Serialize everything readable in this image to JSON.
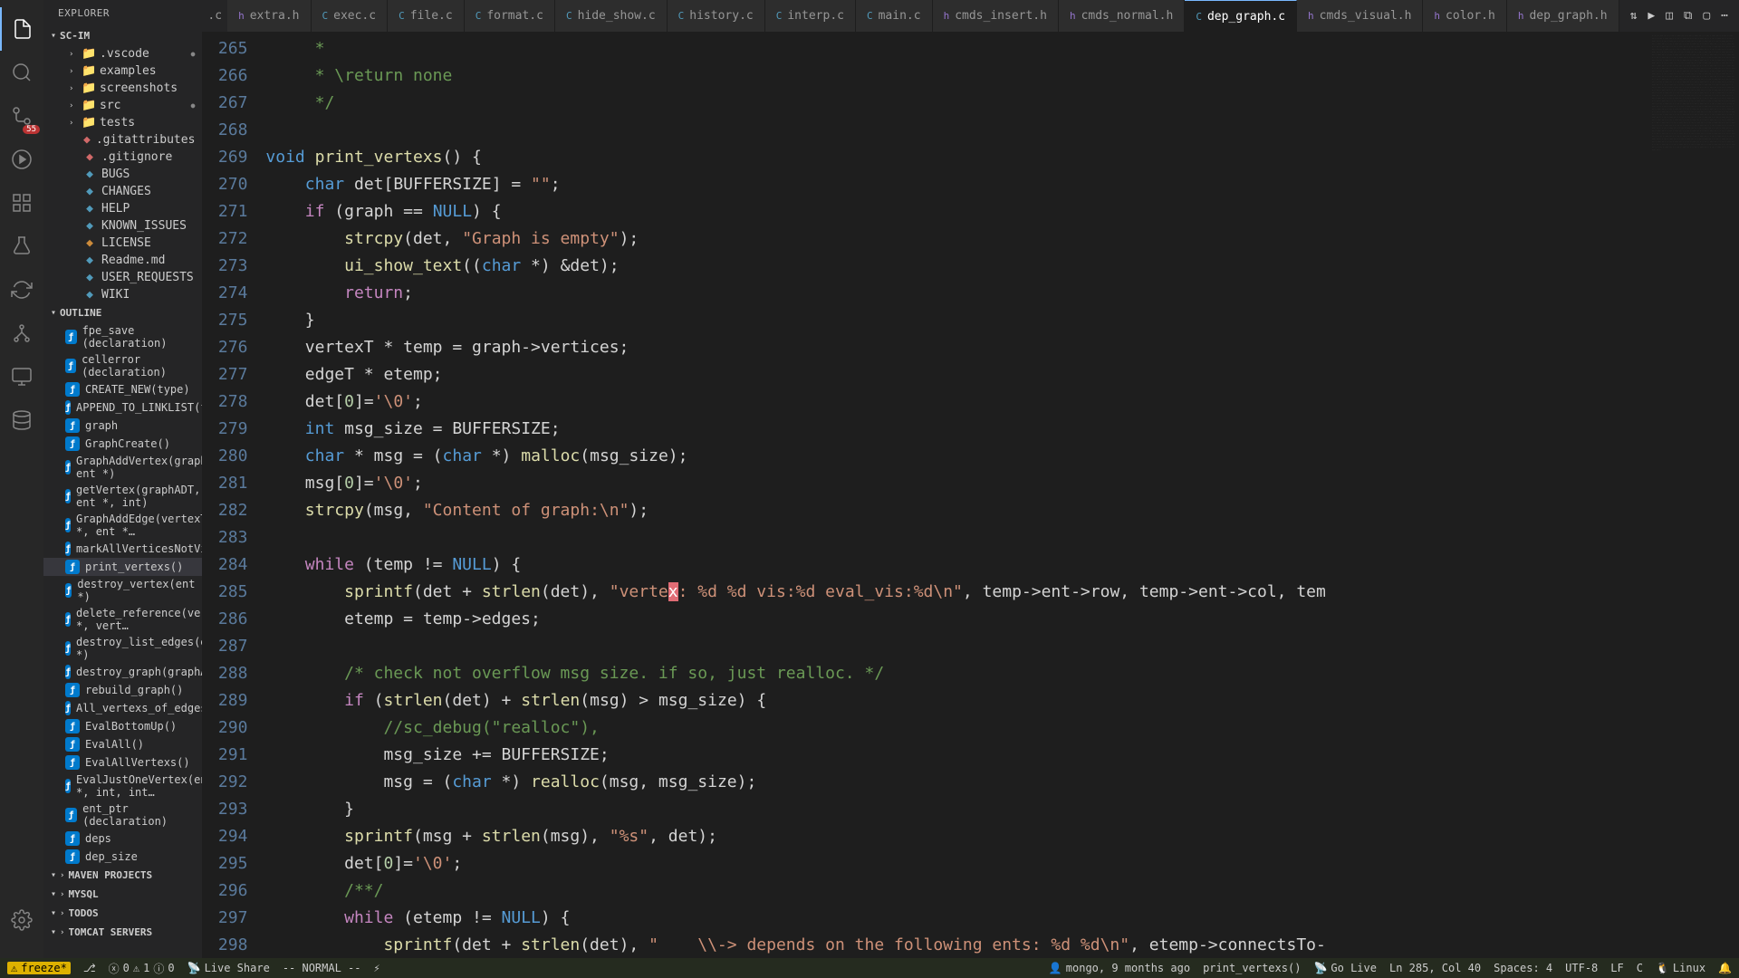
{
  "explorer": {
    "title": "EXPLORER"
  },
  "project": {
    "name": "SC-IM"
  },
  "tree": {
    "folders": [
      {
        "name": ".vscode",
        "dotted": true
      },
      {
        "name": "examples",
        "dotted": false
      },
      {
        "name": "screenshots",
        "dotted": false
      },
      {
        "name": "src",
        "dotted": true
      },
      {
        "name": "tests",
        "dotted": false
      }
    ],
    "files": [
      {
        "name": ".gitattributes",
        "color": "file-red"
      },
      {
        "name": ".gitignore",
        "color": "file-red"
      },
      {
        "name": "BUGS",
        "color": "file-blue"
      },
      {
        "name": "CHANGES",
        "color": "file-blue"
      },
      {
        "name": "HELP",
        "color": "file-blue"
      },
      {
        "name": "KNOWN_ISSUES",
        "color": "file-blue"
      },
      {
        "name": "LICENSE",
        "color": "file-orange"
      },
      {
        "name": "Readme.md",
        "color": "file-blue"
      },
      {
        "name": "USER_REQUESTS",
        "color": "file-blue"
      },
      {
        "name": "WIKI",
        "color": "file-blue"
      }
    ]
  },
  "outline": {
    "title": "OUTLINE",
    "items": [
      "fpe_save (declaration)",
      "cellerror (declaration)",
      "CREATE_NEW(type)",
      "APPEND_TO_LINKLIST(firstNod…",
      "graph",
      "GraphCreate()",
      "GraphAddVertex(graphADT, ent *)",
      "getVertex(graphADT, ent *, int)",
      "GraphAddEdge(vertexT *, ent *…",
      "markAllVerticesNotVisited(int)",
      "print_vertexs()",
      "destroy_vertex(ent *)",
      "delete_reference(vertexT *, vert…",
      "destroy_list_edges(edgeT *)",
      "destroy_graph(graphADT)",
      "rebuild_graph()",
      "All_vertexs_of_edges_visited(ed…",
      "EvalBottomUp()",
      "EvalAll()",
      "EvalAllVertexs()",
      "EvalJustOneVertex(ent *, int, int…",
      "ent_ptr (declaration)",
      "deps",
      "dep_size"
    ],
    "selected": 10
  },
  "bottom_sections": [
    "MAVEN PROJECTS",
    "MYSQL",
    "TODOS",
    "TOMCAT SERVERS"
  ],
  "tabs": {
    "items": [
      {
        "label": "extra.h",
        "type": "h"
      },
      {
        "label": "exec.c",
        "type": "c"
      },
      {
        "label": "file.c",
        "type": "c"
      },
      {
        "label": "format.c",
        "type": "c"
      },
      {
        "label": "hide_show.c",
        "type": "c"
      },
      {
        "label": "history.c",
        "type": "c"
      },
      {
        "label": "interp.c",
        "type": "c"
      },
      {
        "label": "main.c",
        "type": "c"
      },
      {
        "label": "cmds_insert.h",
        "type": "h"
      },
      {
        "label": "cmds_normal.h",
        "type": "h"
      },
      {
        "label": "dep_graph.c",
        "type": "c",
        "active": true
      },
      {
        "label": "cmds_visual.h",
        "type": "h"
      },
      {
        "label": "color.h",
        "type": "h"
      },
      {
        "label": "dep_graph.h",
        "type": "h"
      }
    ]
  },
  "code": {
    "start": 265,
    "lines": [
      {
        "n": 265,
        "html": "    <span class='comment'> *</span>"
      },
      {
        "n": 266,
        "html": "    <span class='comment'> * \\return none</span>"
      },
      {
        "n": 267,
        "html": "    <span class='comment'> */</span>"
      },
      {
        "n": 268,
        "html": ""
      },
      {
        "n": 269,
        "html": "<span class='type'>void</span> <span class='func'>print_vertexs</span>() {"
      },
      {
        "n": 270,
        "html": "    <span class='type'>char</span> det[BUFFERSIZE] = <span class='str'>\"\"</span>;"
      },
      {
        "n": 271,
        "html": "    <span class='kw'>if</span> (graph == <span class='type'>NULL</span>) {"
      },
      {
        "n": 272,
        "html": "        <span class='func'>strcpy</span>(det, <span class='str'>\"Graph is empty\"</span>);"
      },
      {
        "n": 273,
        "html": "        <span class='func'>ui_show_text</span>((<span class='type'>char</span> *) &amp;det);"
      },
      {
        "n": 274,
        "html": "        <span class='kw'>return</span>;"
      },
      {
        "n": 275,
        "html": "    }"
      },
      {
        "n": 276,
        "html": "    vertexT * temp = graph-&gt;vertices;"
      },
      {
        "n": 277,
        "html": "    edgeT * etemp;"
      },
      {
        "n": 278,
        "html": "    det[<span class='num'>0</span>]=<span class='str'>'\\0'</span>;"
      },
      {
        "n": 279,
        "html": "    <span class='type'>int</span> msg_size = BUFFERSIZE;"
      },
      {
        "n": 280,
        "html": "    <span class='type'>char</span> * msg = (<span class='type'>char</span> *) <span class='func'>malloc</span>(msg_size);"
      },
      {
        "n": 281,
        "html": "    msg[<span class='num'>0</span>]=<span class='str'>'\\0'</span>;"
      },
      {
        "n": 282,
        "html": "    <span class='func'>strcpy</span>(msg, <span class='str'>\"Content of graph:\\n\"</span>);"
      },
      {
        "n": 283,
        "html": ""
      },
      {
        "n": 284,
        "html": "    <span class='kw'>while</span> (temp != <span class='type'>NULL</span>) {"
      },
      {
        "n": 285,
        "html": "        <span class='func'>sprintf</span>(det + <span class='func'>strlen</span>(det), <span class='str'>\"verte<span class='caret'>x</span>: %d %d vis:%d eval_vis:%d\\n\"</span>, temp-&gt;ent-&gt;row, temp-&gt;ent-&gt;col, tem"
      },
      {
        "n": 286,
        "html": "        etemp = temp-&gt;edges;"
      },
      {
        "n": 287,
        "html": ""
      },
      {
        "n": 288,
        "html": "        <span class='comment'>/* check not overflow msg size. if so, just realloc. */</span>"
      },
      {
        "n": 289,
        "html": "        <span class='kw'>if</span> (<span class='func'>strlen</span>(det) + <span class='func'>strlen</span>(msg) &gt; msg_size) {"
      },
      {
        "n": 290,
        "html": "            <span class='comment'>//sc_debug(\"realloc\"),</span>"
      },
      {
        "n": 291,
        "html": "            msg_size += BUFFERSIZE;"
      },
      {
        "n": 292,
        "html": "            msg = (<span class='type'>char</span> *) <span class='func'>realloc</span>(msg, msg_size);"
      },
      {
        "n": 293,
        "html": "        }"
      },
      {
        "n": 294,
        "html": "        <span class='func'>sprintf</span>(msg + <span class='func'>strlen</span>(msg), <span class='str'>\"%s\"</span>, det);"
      },
      {
        "n": 295,
        "html": "        det[<span class='num'>0</span>]=<span class='str'>'\\0'</span>;"
      },
      {
        "n": 296,
        "html": "        <span class='comment'>/**/</span>"
      },
      {
        "n": 297,
        "html": "        <span class='kw'>while</span> (etemp != <span class='type'>NULL</span>) {"
      },
      {
        "n": 298,
        "html": "            <span class='func'>sprintf</span>(det + <span class='func'>strlen</span>(det), <span class='str'>\"    \\\\-&gt; depends on the following ents: %d %d\\n\"</span>, etemp-&gt;connectsTo-"
      }
    ]
  },
  "status": {
    "freeze": "freeze*",
    "branch": "",
    "errors": "0",
    "warnings": "1",
    "zero": "0",
    "liveshare": "Live Share",
    "mode": "-- NORMAL --",
    "blame": "mongo, 9 months ago",
    "func": "print_vertexs()",
    "golive": "Go Live",
    "pos": "Ln 285, Col 40",
    "spaces": "Spaces: 4",
    "enc": "UTF-8",
    "eol": "LF",
    "lang": "C",
    "os": "Linux"
  }
}
